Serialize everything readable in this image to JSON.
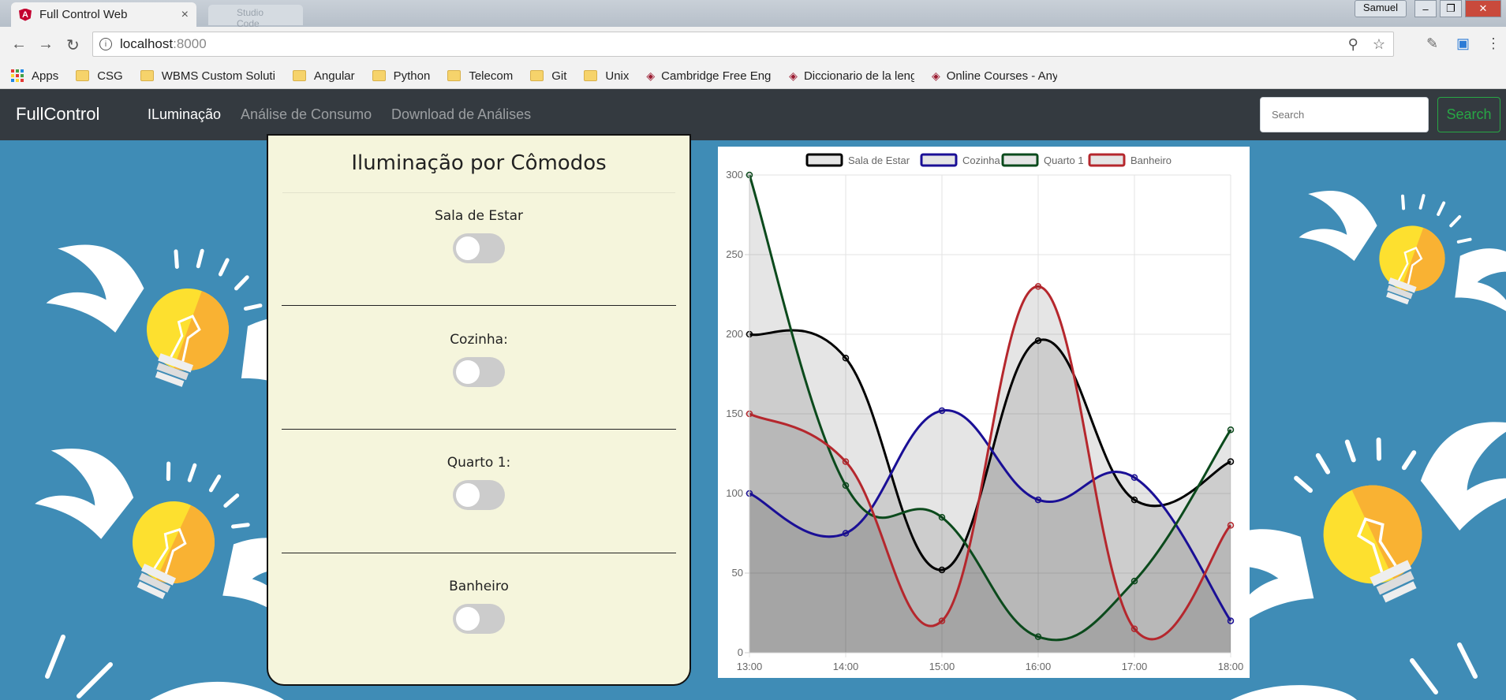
{
  "browser": {
    "tab_title": "Full Control Web",
    "tab_close": "×",
    "tab2_title": "Studio Code",
    "user": "Samuel",
    "url_host": "localhost",
    "url_port": ":8000"
  },
  "bookmarks": [
    {
      "label": "Apps",
      "type": "apps"
    },
    {
      "label": "CSG",
      "type": "folder"
    },
    {
      "label": "WBMS Custom Soluti",
      "type": "folder"
    },
    {
      "label": "Angular",
      "type": "folder"
    },
    {
      "label": "Python",
      "type": "folder"
    },
    {
      "label": "Telecom",
      "type": "folder"
    },
    {
      "label": "Git",
      "type": "folder"
    },
    {
      "label": "Unix",
      "type": "folder"
    },
    {
      "label": "Cambridge Free Engli",
      "type": "site"
    },
    {
      "label": "Diccionario de la leng",
      "type": "site"
    },
    {
      "label": "Online Courses - Any",
      "type": "site"
    }
  ],
  "navbar": {
    "brand": "FullControl",
    "links": [
      "ILuminação",
      "Análise de Consumo",
      "Download de Análises"
    ],
    "search_placeholder": "Search",
    "search_button": "Search"
  },
  "panel": {
    "title": "Iluminação por Cômodos",
    "rooms": [
      {
        "label": "Sala de Estar",
        "on": false
      },
      {
        "label": "Cozinha:",
        "on": false
      },
      {
        "label": "Quarto 1:",
        "on": false
      },
      {
        "label": "Banheiro",
        "on": false
      }
    ]
  },
  "chart_data": {
    "type": "line",
    "categories": [
      "13:00",
      "14:00",
      "15:00",
      "16:00",
      "17:00",
      "18:00"
    ],
    "ylim": [
      0,
      300
    ],
    "yticks": [
      0,
      50,
      100,
      150,
      200,
      250,
      300
    ],
    "grid": true,
    "legend_position": "top",
    "series": [
      {
        "name": "Sala de Estar",
        "color": "#000000",
        "fill": "rgba(0,0,0,0.10)",
        "values": [
          200,
          185,
          52,
          196,
          96,
          120
        ]
      },
      {
        "name": "Cozinha",
        "color": "#1a0f96",
        "fill": "rgba(0,0,0,0.10)",
        "values": [
          100,
          75,
          152,
          96,
          110,
          20
        ]
      },
      {
        "name": "Quarto 1",
        "color": "#0b4a1c",
        "fill": "rgba(0,0,0,0.10)",
        "values": [
          300,
          105,
          85,
          10,
          45,
          140
        ]
      },
      {
        "name": "Banheiro",
        "color": "#b5272d",
        "fill": "rgba(0,0,0,0.10)",
        "values": [
          150,
          120,
          20,
          230,
          15,
          80
        ]
      }
    ]
  }
}
